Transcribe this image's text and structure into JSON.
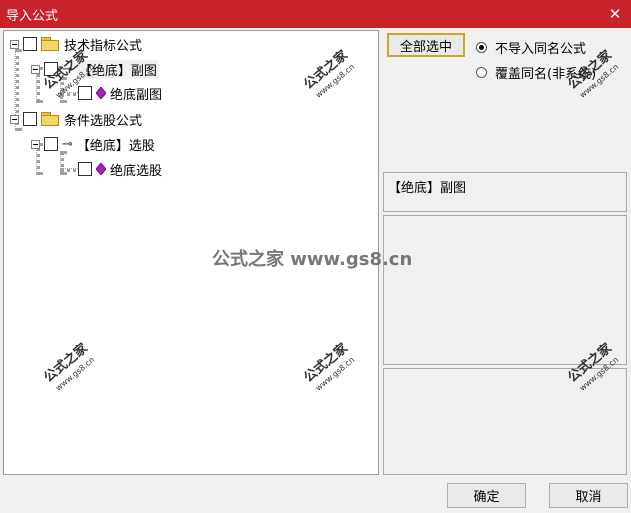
{
  "window": {
    "title": "导入公式",
    "close_glyph": "✕"
  },
  "tree": {
    "items": [
      {
        "label": "技术指标公式",
        "icon": "folder-icon"
      },
      {
        "label": "【绝底】副图",
        "icon": "key-icon"
      },
      {
        "label": "绝底副图",
        "icon": "gem-icon"
      },
      {
        "label": "条件选股公式",
        "icon": "folder-icon"
      },
      {
        "label": "【绝底】选股",
        "icon": "key-icon"
      },
      {
        "label": "绝底选股",
        "icon": "gem-icon"
      }
    ]
  },
  "options": {
    "select_all_label": "全部选中",
    "radio_skip_label": "不导入同名公式",
    "radio_overwrite_label": "覆盖同名(非系统)",
    "selected_option": "skip"
  },
  "formula_name": "【绝底】副图",
  "footer": {
    "ok_label": "确定",
    "cancel_label": "取消"
  },
  "watermark": {
    "brand": "公式之家",
    "url": "www.gs8.cn",
    "center_text": "公式之家 www.gs8.cn"
  },
  "colors": {
    "titlebar": "#c8232b",
    "button_focus_border": "#c9a72a",
    "gem": "#a020c0"
  }
}
